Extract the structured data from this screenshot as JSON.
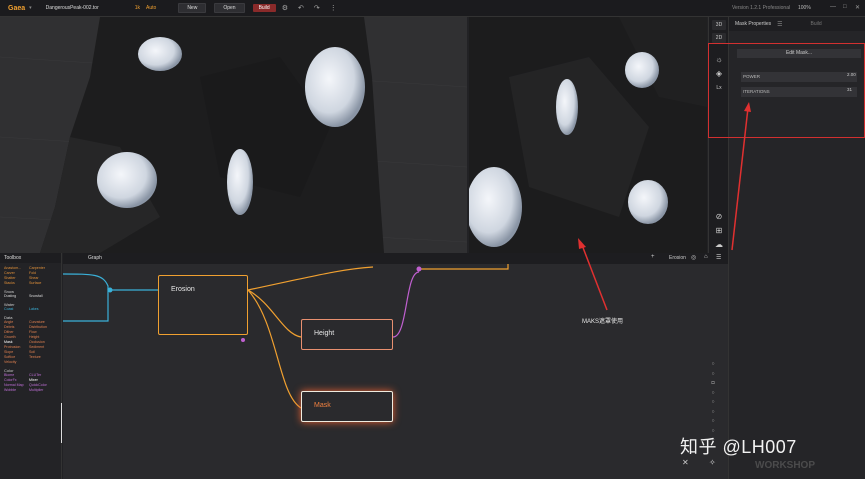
{
  "app": {
    "name": "Gaea",
    "file": "DangerousPeak-002.tor",
    "resolution": "1k",
    "mode": "Auto",
    "version": "Version 1.2.1 Professional",
    "zoom": "100%"
  },
  "toolbar": {
    "new_label": "New",
    "open_label": "Open",
    "build_label": "Build"
  },
  "side_modes": {
    "mode3d": "3D",
    "mode2d": "2D",
    "lx": "Lx"
  },
  "properties": {
    "tab_mask": "Mask Properties",
    "tab_build": "Build",
    "edit_mask": "Edit Mask...",
    "fields": [
      {
        "label": "POWER",
        "value": "2.00"
      },
      {
        "label": "ITERATIONS",
        "value": "31"
      }
    ]
  },
  "graph": {
    "tab": "Graph",
    "search": "Erosion"
  },
  "toolbox": {
    "title": "Toolbox",
    "top_items": [
      "Anastom...",
      "Carpenter",
      "Carver",
      "Fold",
      "Shatter",
      "Shear",
      "Stacks",
      "Surface"
    ],
    "sections": [
      {
        "name": "Snow",
        "items": [
          "Dusting",
          "Snowfall"
        ]
      },
      {
        "name": "Water",
        "items": [
          "Coast",
          "Lakes"
        ]
      },
      {
        "name": "Data",
        "items": [
          "Angle",
          "Curvature",
          "Debris",
          "Distribution",
          "Dither",
          "Flow",
          "Growth",
          "Height",
          "Mask",
          "Occlusion",
          "Protrusion",
          "Sediment",
          "Slope",
          "Soil",
          "SoftIce",
          "Texture",
          "Velocity",
          ""
        ]
      },
      {
        "name": "Color",
        "items": [
          "Biome",
          "CLUTer",
          "ColorFx",
          "Mixer",
          "Normal Map",
          "QuickColor",
          "Wobble",
          "Multiplier"
        ]
      }
    ]
  },
  "nodes": {
    "erosion": "Erosion",
    "height": "Height",
    "mask": "Mask"
  },
  "annotation": "MAKS遮罩使用",
  "watermark": {
    "zhihu": "知乎 @LH007",
    "brand": "WORKSHOP"
  },
  "colors": {
    "accent": "#f0a030",
    "highlight": "#d23030",
    "wire_blue": "#3ab0d8",
    "wire_orange": "#f0a030",
    "wire_purple": "#c060d0"
  }
}
